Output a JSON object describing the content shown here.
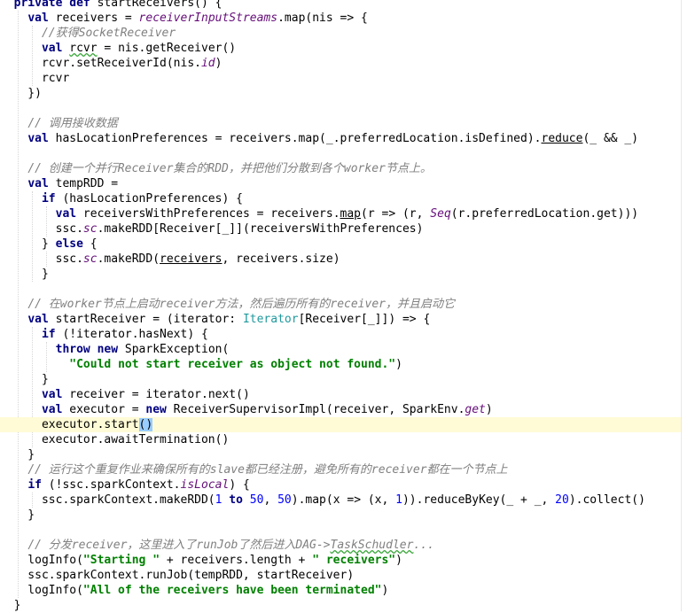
{
  "editor": {
    "lines": [
      [
        {
          "t": "  ",
          "c": "tx"
        },
        {
          "t": "private def",
          "c": "kw"
        },
        {
          "t": " startReceivers() {",
          "c": "tx"
        }
      ],
      [
        {
          "t": "    ",
          "c": "tx"
        },
        {
          "t": "val",
          "c": "kw"
        },
        {
          "t": " receivers = ",
          "c": "tx"
        },
        {
          "t": "receiverInputStreams",
          "c": "fi"
        },
        {
          "t": ".map(nis => {",
          "c": "tx"
        }
      ],
      [
        {
          "t": "      ",
          "c": "tx"
        },
        {
          "t": "//获得SocketReceiver",
          "c": "cm"
        }
      ],
      [
        {
          "t": "      ",
          "c": "tx"
        },
        {
          "t": "val",
          "c": "kw"
        },
        {
          "t": " ",
          "c": "tx"
        },
        {
          "t": "rcvr",
          "c": "tx wv"
        },
        {
          "t": " = nis.getReceiver()",
          "c": "tx"
        }
      ],
      [
        {
          "t": "      rcvr.setReceiverId(nis.",
          "c": "tx"
        },
        {
          "t": "id",
          "c": "fi"
        },
        {
          "t": ")",
          "c": "tx"
        }
      ],
      [
        {
          "t": "      rcvr",
          "c": "tx"
        }
      ],
      [
        {
          "t": "    })",
          "c": "tx"
        }
      ],
      [],
      [
        {
          "t": "    ",
          "c": "tx"
        },
        {
          "t": "// 调用接收数据",
          "c": "cm"
        }
      ],
      [
        {
          "t": "    ",
          "c": "tx"
        },
        {
          "t": "val",
          "c": "kw"
        },
        {
          "t": " hasLocationPreferences = receivers.map(_.preferredLocation.isDefined).",
          "c": "tx"
        },
        {
          "t": "reduce",
          "c": "tx ul"
        },
        {
          "t": "(_ && _)",
          "c": "tx"
        }
      ],
      [],
      [
        {
          "t": "    ",
          "c": "tx"
        },
        {
          "t": "// 创建一个并行Receiver集合的RDD，并把他们分散到各个worker节点上。",
          "c": "cm"
        }
      ],
      [
        {
          "t": "    ",
          "c": "tx"
        },
        {
          "t": "val",
          "c": "kw"
        },
        {
          "t": " tempRDD =",
          "c": "tx"
        }
      ],
      [
        {
          "t": "      ",
          "c": "tx"
        },
        {
          "t": "if",
          "c": "kw"
        },
        {
          "t": " (hasLocationPreferences) {",
          "c": "tx"
        }
      ],
      [
        {
          "t": "        ",
          "c": "tx"
        },
        {
          "t": "val",
          "c": "kw"
        },
        {
          "t": " receiversWithPreferences = receivers.",
          "c": "tx"
        },
        {
          "t": "map",
          "c": "tx ul"
        },
        {
          "t": "(r => (r, ",
          "c": "tx"
        },
        {
          "t": "Seq",
          "c": "fi"
        },
        {
          "t": "(r.preferredLocation.get)))",
          "c": "tx"
        }
      ],
      [
        {
          "t": "        ssc.",
          "c": "tx"
        },
        {
          "t": "sc",
          "c": "fi"
        },
        {
          "t": ".makeRDD[Receiver[_]](receiversWithPreferences)",
          "c": "tx"
        }
      ],
      [
        {
          "t": "      } ",
          "c": "tx"
        },
        {
          "t": "else",
          "c": "kw"
        },
        {
          "t": " {",
          "c": "tx"
        }
      ],
      [
        {
          "t": "        ssc.",
          "c": "tx"
        },
        {
          "t": "sc",
          "c": "fi"
        },
        {
          "t": ".makeRDD(",
          "c": "tx"
        },
        {
          "t": "receivers",
          "c": "tx ul"
        },
        {
          "t": ", receivers.size)",
          "c": "tx"
        }
      ],
      [
        {
          "t": "      }",
          "c": "tx"
        }
      ],
      [],
      [
        {
          "t": "    ",
          "c": "tx"
        },
        {
          "t": "// 在worker节点上启动receiver方法，然后遍历所有的receiver，并且启动它",
          "c": "cm"
        }
      ],
      [
        {
          "t": "    ",
          "c": "tx"
        },
        {
          "t": "val",
          "c": "kw"
        },
        {
          "t": " startReceiver = (iterator: ",
          "c": "tx"
        },
        {
          "t": "Iterator",
          "c": "ty"
        },
        {
          "t": "[Receiver[_]]) => {",
          "c": "tx"
        }
      ],
      [
        {
          "t": "      ",
          "c": "tx"
        },
        {
          "t": "if",
          "c": "kw"
        },
        {
          "t": " (!iterator.hasNext) {",
          "c": "tx"
        }
      ],
      [
        {
          "t": "        ",
          "c": "tx"
        },
        {
          "t": "throw new",
          "c": "kw"
        },
        {
          "t": " SparkException(",
          "c": "tx"
        }
      ],
      [
        {
          "t": "          ",
          "c": "tx"
        },
        {
          "t": "\"Could not start receiver as object not found.\"",
          "c": "st"
        },
        {
          "t": ")",
          "c": "tx"
        }
      ],
      [
        {
          "t": "      }",
          "c": "tx"
        }
      ],
      [
        {
          "t": "      ",
          "c": "tx"
        },
        {
          "t": "val",
          "c": "kw"
        },
        {
          "t": " receiver = iterator.next()",
          "c": "tx"
        }
      ],
      [
        {
          "t": "      ",
          "c": "tx"
        },
        {
          "t": "val",
          "c": "kw"
        },
        {
          "t": " executor = ",
          "c": "tx"
        },
        {
          "t": "new",
          "c": "kw"
        },
        {
          "t": " ReceiverSupervisorImpl(receiver, SparkEnv.",
          "c": "tx"
        },
        {
          "t": "get",
          "c": "fi"
        },
        {
          "t": ")",
          "c": "tx"
        }
      ],
      [
        {
          "t": "      executor.start",
          "c": "tx"
        },
        {
          "t": "()",
          "c": "tx bm"
        }
      ],
      [
        {
          "t": "      executor.awaitTermination()",
          "c": "tx"
        }
      ],
      [
        {
          "t": "    }",
          "c": "tx"
        }
      ],
      [
        {
          "t": "    ",
          "c": "tx"
        },
        {
          "t": "// 运行这个重复作业来确保所有的slave都已经注册，避免所有的receiver都在一个节点上",
          "c": "cm"
        }
      ],
      [
        {
          "t": "    ",
          "c": "tx"
        },
        {
          "t": "if",
          "c": "kw"
        },
        {
          "t": " (!ssc.sparkContext.",
          "c": "tx"
        },
        {
          "t": "isLocal",
          "c": "fi"
        },
        {
          "t": ") {",
          "c": "tx"
        }
      ],
      [
        {
          "t": "      ssc.sparkContext.makeRDD(",
          "c": "tx"
        },
        {
          "t": "1",
          "c": "nm"
        },
        {
          "t": " ",
          "c": "tx"
        },
        {
          "t": "to",
          "c": "kw"
        },
        {
          "t": " ",
          "c": "tx"
        },
        {
          "t": "50",
          "c": "nm"
        },
        {
          "t": ", ",
          "c": "tx"
        },
        {
          "t": "50",
          "c": "nm"
        },
        {
          "t": ").map(x => (x, ",
          "c": "tx"
        },
        {
          "t": "1",
          "c": "nm"
        },
        {
          "t": ")).reduceByKey(_ + _, ",
          "c": "tx"
        },
        {
          "t": "20",
          "c": "nm"
        },
        {
          "t": ").collect()",
          "c": "tx"
        }
      ],
      [
        {
          "t": "    }",
          "c": "tx"
        }
      ],
      [],
      [
        {
          "t": "    ",
          "c": "tx"
        },
        {
          "t": "// 分发receiver，这里进入了runJob了然后进入DAG->",
          "c": "cm"
        },
        {
          "t": "TaskSchudler",
          "c": "cm wv"
        },
        {
          "t": "...",
          "c": "cm"
        }
      ],
      [
        {
          "t": "    logInfo(",
          "c": "tx"
        },
        {
          "t": "\"Starting \"",
          "c": "st"
        },
        {
          "t": " + receivers.length + ",
          "c": "tx"
        },
        {
          "t": "\" receivers\"",
          "c": "st"
        },
        {
          "t": ")",
          "c": "tx"
        }
      ],
      [
        {
          "t": "    ssc.sparkContext.runJob(tempRDD, startReceiver)",
          "c": "tx"
        }
      ],
      [
        {
          "t": "    logInfo(",
          "c": "tx"
        },
        {
          "t": "\"All of the receivers have been terminated\"",
          "c": "st"
        },
        {
          "t": ")",
          "c": "tx"
        }
      ],
      [
        {
          "t": "  }",
          "c": "tx"
        }
      ]
    ],
    "current_line": 28
  }
}
